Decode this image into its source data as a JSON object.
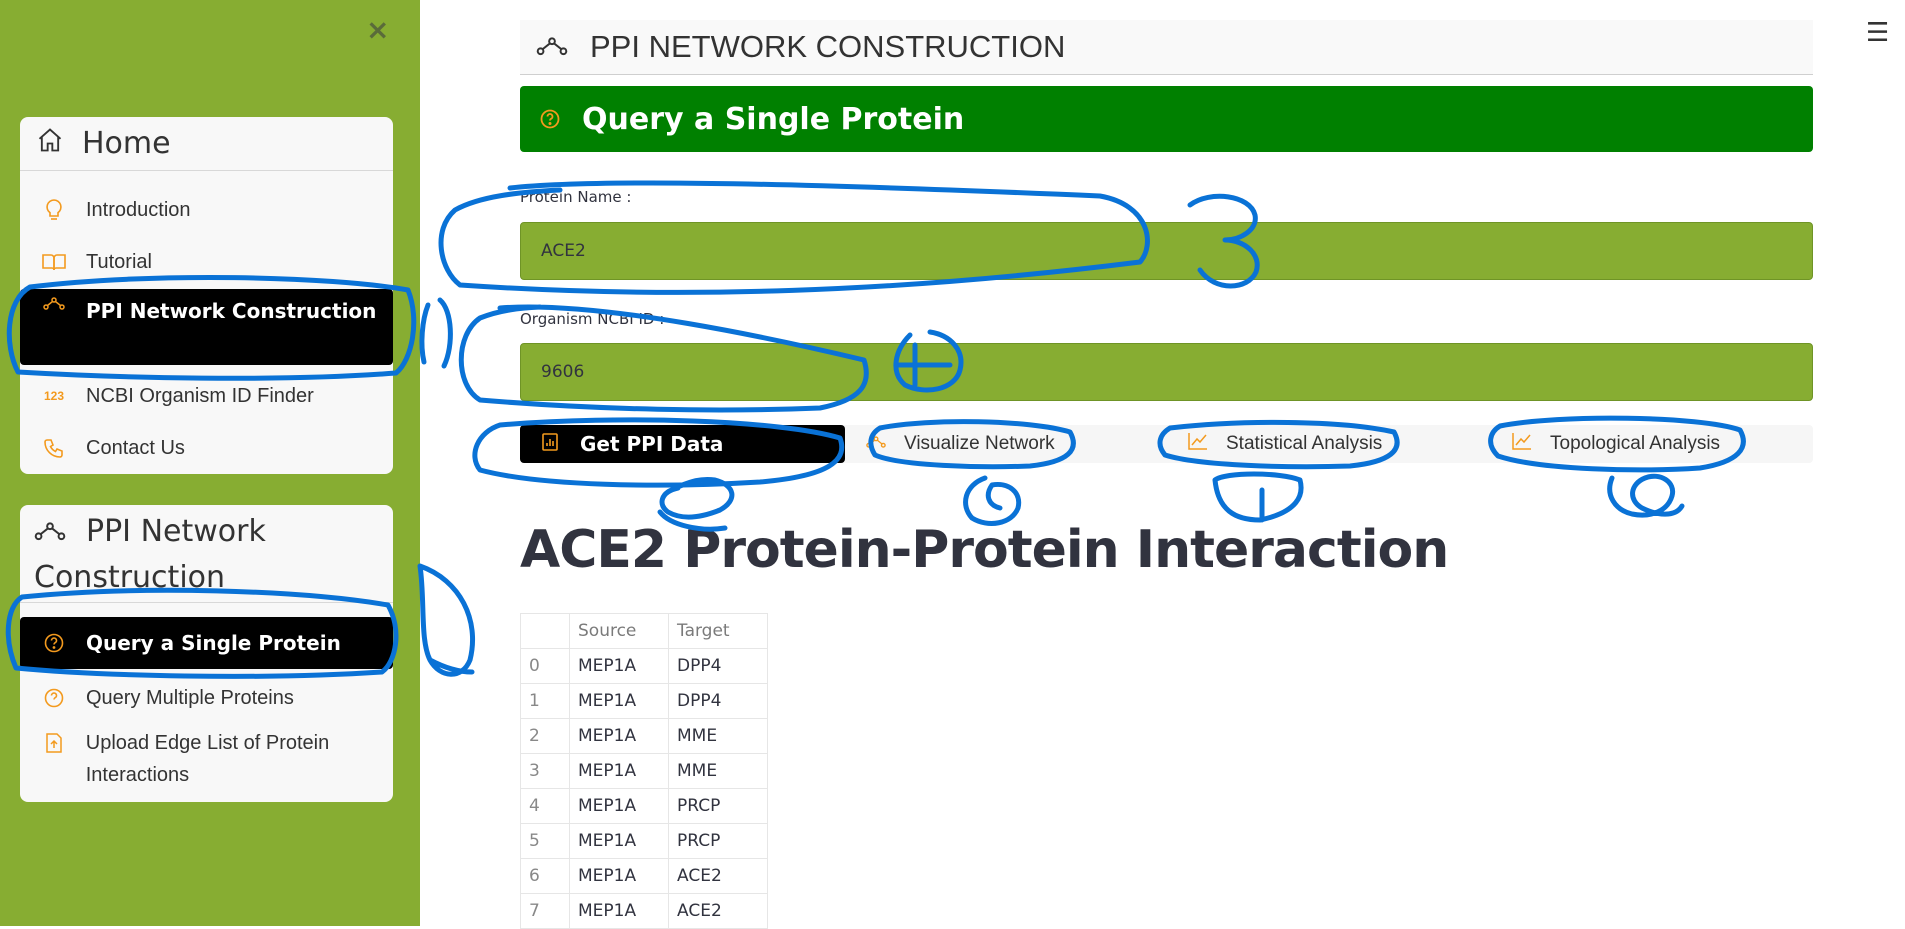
{
  "sidebar": {
    "close_label": "×",
    "home_card": {
      "title": "Home",
      "items": [
        {
          "label": "Introduction",
          "icon": "lightbulb-icon"
        },
        {
          "label": "Tutorial",
          "icon": "book-icon"
        },
        {
          "label": "PPI Network Construction",
          "icon": "network-icon",
          "active": true
        },
        {
          "label": "NCBI Organism ID Finder",
          "icon": "numbers-123-icon"
        },
        {
          "label": "Contact Us",
          "icon": "phone-icon"
        }
      ]
    },
    "ppi_card": {
      "title": "PPI Network Construction",
      "items": [
        {
          "label": "Query a Single Protein",
          "icon": "question-circle-icon",
          "active": true
        },
        {
          "label": "Query Multiple Proteins",
          "icon": "question-circle-icon"
        },
        {
          "label": "Upload Edge List of Protein Interactions",
          "icon": "upload-file-icon"
        }
      ]
    }
  },
  "header": {
    "title": "PPI NETWORK CONSTRUCTION",
    "hamburger": "☰"
  },
  "banner": {
    "title": "Query a Single Protein"
  },
  "form": {
    "protein_label": "Protein Name :",
    "protein_value": "ACE2",
    "organism_label": "Organism NCBI ID :",
    "organism_value": "9606"
  },
  "buttons": {
    "get_data": "Get PPI Data",
    "visualize": "Visualize Network",
    "statistical": "Statistical Analysis",
    "topological": "Topological Analysis"
  },
  "result": {
    "title": "ACE2 Protein-Protein Interaction",
    "columns": [
      "",
      "Source",
      "Target"
    ],
    "rows": [
      [
        "0",
        "MEP1A",
        "DPP4"
      ],
      [
        "1",
        "MEP1A",
        "DPP4"
      ],
      [
        "2",
        "MEP1A",
        "MME"
      ],
      [
        "3",
        "MEP1A",
        "MME"
      ],
      [
        "4",
        "MEP1A",
        "PRCP"
      ],
      [
        "5",
        "MEP1A",
        "PRCP"
      ],
      [
        "6",
        "MEP1A",
        "ACE2"
      ],
      [
        "7",
        "MEP1A",
        "ACE2"
      ]
    ]
  },
  "annotations": [
    "1",
    "2",
    "3",
    "4",
    "5",
    "6",
    "7",
    "8"
  ],
  "colors": {
    "sidebar_bg": "#87ad32",
    "banner_bg": "#008000",
    "field_bg": "#87ad32",
    "accent_orange": "#f39a1e",
    "annotation_blue": "#0a72d6",
    "active_bg": "#000000"
  }
}
